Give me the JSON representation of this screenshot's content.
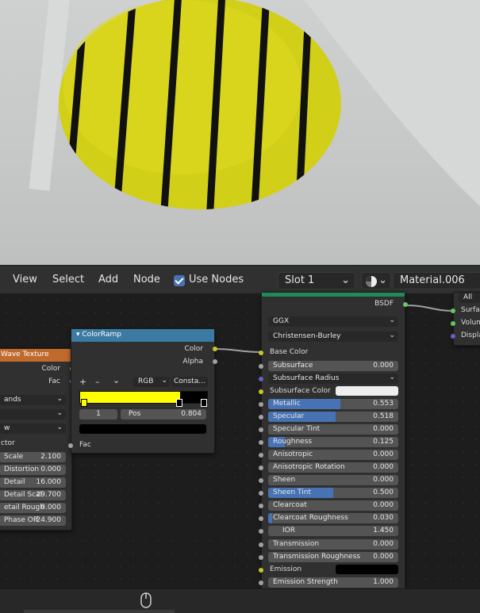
{
  "header": {
    "menus": [
      "View",
      "Select",
      "Add",
      "Node"
    ],
    "use_nodes": "Use Nodes",
    "slot": "Slot 1",
    "material": "Material.006"
  },
  "wave": {
    "title": "Wave Texture",
    "outputs": [
      "Color",
      "Fac"
    ],
    "dropdowns": [
      "ands",
      "",
      "w"
    ],
    "section": "ctor",
    "params": [
      {
        "label": "Scale",
        "value": "2.100"
      },
      {
        "label": "Distortion",
        "value": "0.000"
      },
      {
        "label": "Detail",
        "value": "16.000"
      },
      {
        "label": "Detail Scal",
        "value": "29.700"
      },
      {
        "label": "etail Rough",
        "value": "0.000"
      },
      {
        "label": "Phase Off",
        "value": "-24.900"
      }
    ]
  },
  "colorramp": {
    "title": "ColorRamp",
    "outputs": [
      "Color",
      "Alpha"
    ],
    "mode": "RGB",
    "interp": "Consta...",
    "index": "1",
    "pos_label": "Pos",
    "pos_value": "0.804",
    "input": "Fac",
    "add": "+",
    "remove": "–",
    "more": "⌄"
  },
  "bsdf": {
    "output": "BSDF",
    "distribution": "GGX",
    "subsurface_method": "Christensen-Burley",
    "base_color": "Base Color",
    "rows": [
      {
        "label": "Subsurface",
        "value": "0.000",
        "fill": 0
      },
      {
        "label": "Subsurface Radius",
        "value": "",
        "fill": 0
      },
      {
        "label": "Subsurface Color",
        "value": "",
        "fill": 0
      },
      {
        "label": "Metallic",
        "value": "0.553",
        "fill": 0.553
      },
      {
        "label": "Specular",
        "value": "0.518",
        "fill": 0.518
      },
      {
        "label": "Specular Tint",
        "value": "0.000",
        "fill": 0
      },
      {
        "label": "Roughness",
        "value": "0.125",
        "fill": 0.125
      },
      {
        "label": "Anisotropic",
        "value": "0.000",
        "fill": 0
      },
      {
        "label": "Anisotropic Rotation",
        "value": "0.000",
        "fill": 0
      },
      {
        "label": "Sheen",
        "value": "0.000",
        "fill": 0
      },
      {
        "label": "Sheen Tint",
        "value": "0.500",
        "fill": 0.5
      },
      {
        "label": "Clearcoat",
        "value": "0.000",
        "fill": 0
      },
      {
        "label": "Clearcoat Roughness",
        "value": "0.030",
        "fill": 0.03
      },
      {
        "label": "IOR",
        "value": "1.450",
        "fill": 0
      },
      {
        "label": "Transmission",
        "value": "0.000",
        "fill": 0
      },
      {
        "label": "Transmission Roughness",
        "value": "0.000",
        "fill": 0
      },
      {
        "label": "Emission",
        "value": "",
        "fill": 0
      },
      {
        "label": "Emission Strength",
        "value": "1.000",
        "fill": 0
      }
    ]
  },
  "output_node": {
    "all": "All",
    "inputs": [
      "Surface",
      "Volume",
      "Displa"
    ]
  },
  "colors": {
    "accent": "#4772b3",
    "yellow": "#ffff00",
    "ramp_header": "#3b7aa3",
    "wave_header": "#c06a2c",
    "shader_header": "#1f8a5a"
  }
}
